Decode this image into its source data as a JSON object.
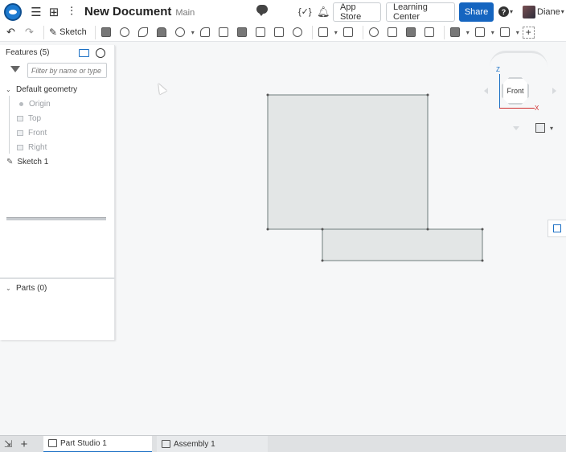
{
  "header": {
    "doc_title": "New Document",
    "branch": "Main",
    "app_store_label": "App Store",
    "learning_center_label": "Learning Center",
    "share_label": "Share",
    "user_name": "Diane",
    "brackets_label": "{✓}",
    "bell_icon": "bell-icon",
    "help_icon": "help-icon"
  },
  "toolbar": {
    "sketch_label": "Sketch"
  },
  "panel": {
    "features_label": "Features (5)",
    "filter_placeholder": "Filter by name or type",
    "tree": {
      "default_geometry": "Default geometry",
      "origin": "Origin",
      "top": "Top",
      "front": "Front",
      "right": "Right",
      "sketch1": "Sketch 1"
    },
    "parts_label": "Parts (0)"
  },
  "viewcube": {
    "face_label": "Front",
    "z_label": "Z",
    "x_label": "X"
  },
  "tabs": [
    {
      "label": "Part Studio 1"
    },
    {
      "label": "Assembly 1"
    }
  ],
  "colors": {
    "accent": "#1565c0",
    "sketch_fill": "#e3e6e6",
    "sketch_stroke": "#6f7c7c"
  }
}
